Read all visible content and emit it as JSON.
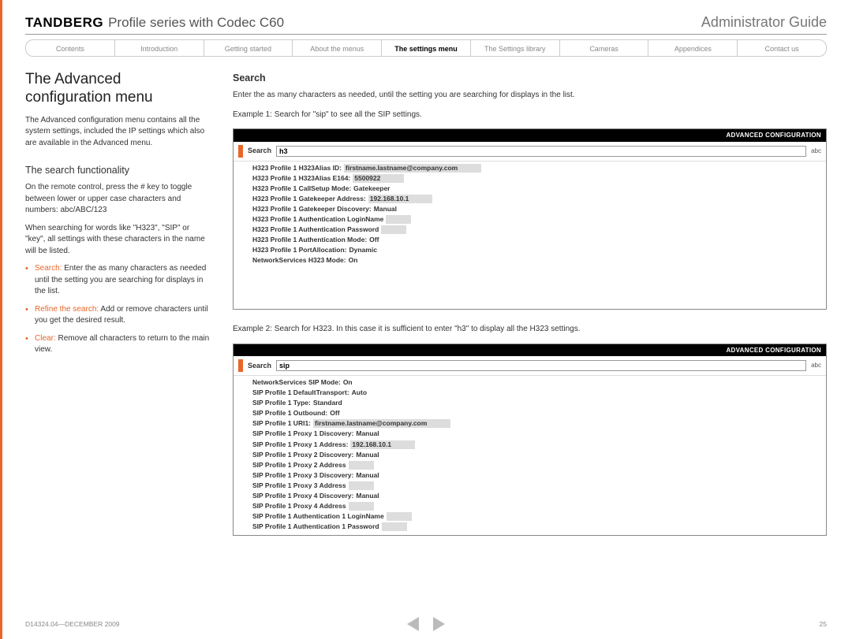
{
  "header": {
    "brand": "TANDBERG",
    "product": "Profile series with Codec C60",
    "guide": "Administrator Guide"
  },
  "nav": {
    "items": [
      "Contents",
      "Introduction",
      "Getting started",
      "About the menus",
      "The settings menu",
      "The Settings library",
      "Cameras",
      "Appendices",
      "Contact us"
    ],
    "activeIndex": 4
  },
  "left": {
    "title": "The Advanced configuration menu",
    "intro": "The Advanced configuration menu contains all the system settings, included the IP settings which also are available in the Advanced menu.",
    "h2": "The search functionality",
    "p1": "On the remote control, press the # key to toggle between lower or upper case characters and numbers: abc/ABC/123",
    "p2": "When searching for words like \"H323\", \"SIP\" or \"key\", all settings with these characters in the name will be listed.",
    "bullets": [
      {
        "term": "Search:",
        "text": " Enter the as many characters as needed until the setting you are searching for displays in the list."
      },
      {
        "term": "Refine the search:",
        "text": " Add or remove characters until you get the desired result."
      },
      {
        "term": "Clear:",
        "text": " Remove all characters to return to the main view."
      }
    ]
  },
  "right": {
    "heading": "Search",
    "intro": "Enter the as many characters as needed, until the setting you are searching for displays in the list.",
    "ex1_caption": "Example 1: Search for \"sip\" to see all the SIP settings.",
    "ex2_caption": "Example 2: Search for H323. In this case it is sufficient to enter \"h3\" to display all the H323 settings."
  },
  "ss_title": "ADVANCED CONFIGURATION",
  "ss_search_label": "Search",
  "ss_abc": "abc",
  "ss1": {
    "query": "h3",
    "rows": [
      {
        "l": "H323 Profile 1 H323Alias ID:",
        "v": "firstname.lastname@company.com",
        "hl": true
      },
      {
        "l": "H323 Profile 1 H323Alias E164:",
        "v": "5500922",
        "hl": true
      },
      {
        "l": "H323 Profile 1 CallSetup Mode:",
        "v": "Gatekeeper"
      },
      {
        "l": "H323 Profile 1 Gatekeeper Address:",
        "v": "192.168.10.1",
        "hl": true
      },
      {
        "l": "H323 Profile 1 Gatekeeper Discovery:",
        "v": "Manual"
      },
      {
        "l": "H323 Profile 1 Authentication LoginName",
        "v": "",
        "hl": true
      },
      {
        "l": "H323 Profile 1 Authentication Password",
        "v": "",
        "hl": true
      },
      {
        "l": "H323 Profile 1 Authentication Mode:",
        "v": "Off"
      },
      {
        "l": "H323 Profile 1 PortAllocation:",
        "v": "Dynamic"
      },
      {
        "l": "NetworkServices H323 Mode:",
        "v": "On"
      }
    ]
  },
  "ss2": {
    "query": "sip",
    "rows": [
      {
        "l": "NetworkServices SIP Mode:",
        "v": "On"
      },
      {
        "l": "SIP Profile 1 DefaultTransport:",
        "v": "Auto"
      },
      {
        "l": "SIP Profile 1 Type:",
        "v": "Standard"
      },
      {
        "l": "SIP Profile 1 Outbound:",
        "v": "Off"
      },
      {
        "l": "SIP Profile 1 URI1:",
        "v": "firstname.lastname@company.com",
        "hl": true
      },
      {
        "l": "SIP Profile 1 Proxy 1 Discovery:",
        "v": "Manual"
      },
      {
        "l": "SIP Profile 1 Proxy 1 Address:",
        "v": "192.168.10.1",
        "hl": true
      },
      {
        "l": "SIP Profile 1 Proxy 2 Discovery:",
        "v": "Manual"
      },
      {
        "l": "SIP Profile 1 Proxy 2 Address",
        "v": "",
        "hl": true
      },
      {
        "l": "SIP Profile 1 Proxy 3 Discovery:",
        "v": "Manual"
      },
      {
        "l": "SIP Profile 1 Proxy 3 Address",
        "v": "",
        "hl": true
      },
      {
        "l": "SIP Profile 1 Proxy 4 Discovery:",
        "v": "Manual"
      },
      {
        "l": "SIP Profile 1 Proxy 4 Address",
        "v": "",
        "hl": true
      },
      {
        "l": "SIP Profile 1 Authentication 1 LoginName",
        "v": "",
        "hl": true
      },
      {
        "l": "SIP Profile 1 Authentication 1 Password",
        "v": "",
        "hl": true
      }
    ]
  },
  "footer": {
    "docid": "D14324.04—DECEMBER 2009",
    "page": "25"
  }
}
